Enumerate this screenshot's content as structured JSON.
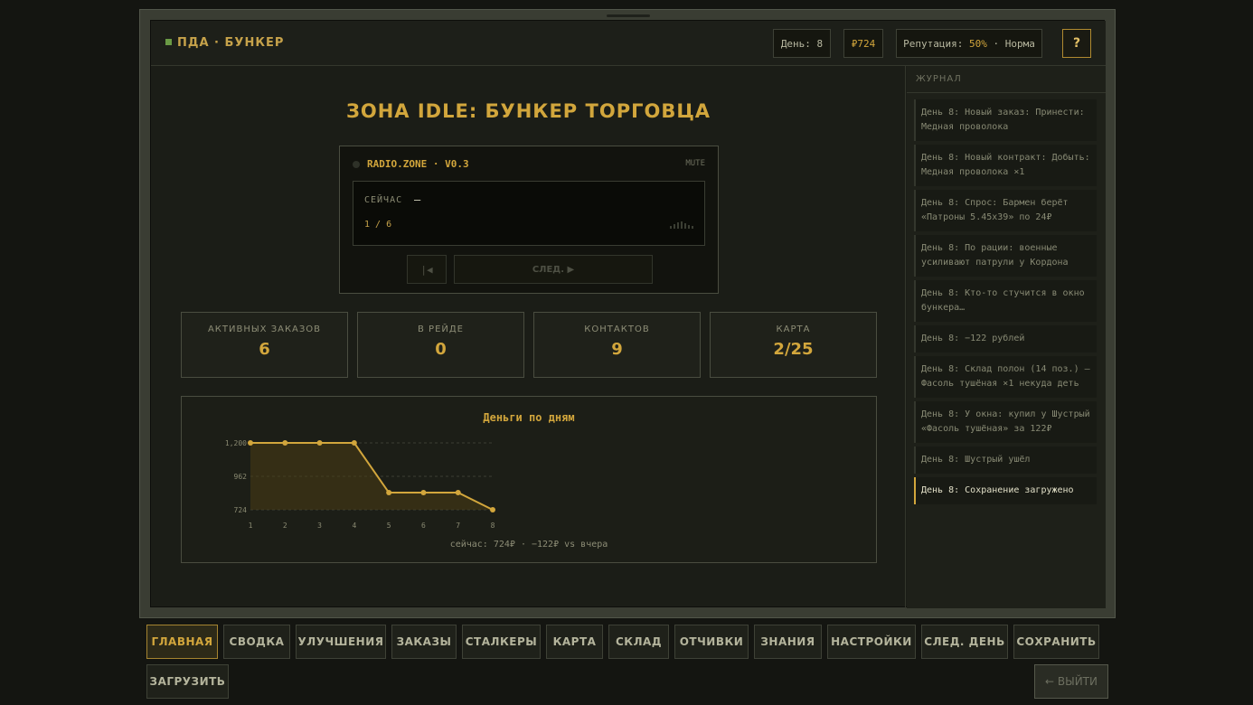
{
  "header": {
    "brand": "ПДА · БУНКЕР",
    "day": "День: 8",
    "money": "₽724",
    "reputation_label": "Репутация: ",
    "reputation_value": "50%",
    "reputation_status": " · Норма",
    "help": "?"
  },
  "main": {
    "title": "ЗОНА IDLE: БУНКЕР ТОРГОВЦА",
    "radio": {
      "name": "RADIO.ZONE · V0.3",
      "mute": "MUTE",
      "now_label": "СЕЙЧАС",
      "now_value": "—",
      "track_count": "1 / 6",
      "prev": "|◀",
      "next": "СЛЕД. ▶"
    },
    "stats": [
      {
        "label": "АКТИВНЫХ ЗАКАЗОВ",
        "value": "6"
      },
      {
        "label": "В РЕЙДЕ",
        "value": "0"
      },
      {
        "label": "КОНТАКТОВ",
        "value": "9"
      },
      {
        "label": "КАРТА",
        "value": "2/25"
      }
    ],
    "chart_footer": "сейчас: 724₽ · −122₽ vs вчера"
  },
  "chart_data": {
    "type": "area",
    "title": "Деньги по дням",
    "x": [
      1,
      2,
      3,
      4,
      5,
      6,
      7,
      8
    ],
    "series": [
      {
        "values": [
          1200,
          1200,
          1200,
          1200,
          846,
          846,
          846,
          724
        ]
      }
    ],
    "yticks": [
      "1,200",
      "962",
      "724"
    ],
    "ylim": [
      724,
      1200
    ],
    "grid": true,
    "colors": {
      "line": "#d2a63c",
      "fill": "#4a3c14"
    }
  },
  "journal": {
    "title": "ЖУРНАЛ",
    "entries": [
      {
        "text": "День 8: Новый заказ: Принести: Медная проволока"
      },
      {
        "text": "День 8: Новый контракт: Добыть: Медная проволока ×1"
      },
      {
        "text": "День 8: Спрос: Бармен берёт «Патроны 5.45x39» по 24₽"
      },
      {
        "text": "День 8: По рации: военные усиливают патрули у Кордона"
      },
      {
        "text": "День 8: Кто-то стучится в окно бункера…"
      },
      {
        "text": "День 8: −122 рублей"
      },
      {
        "text": "День 8: Склад полон (14 поз.) — Фасоль тушёная ×1 некуда деть"
      },
      {
        "text": "День 8: У окна: купил у Шустрый «Фасоль тушёная» за 122₽"
      },
      {
        "text": "День 8: Шустрый ушёл"
      },
      {
        "text": "День 8: Сохранение загружено",
        "active": true
      }
    ]
  },
  "nav": {
    "home": "ГЛАВНАЯ",
    "summary": "СВОДКА",
    "upgrades": "УЛУЧШЕНИЯ",
    "orders": "ЗАКАЗЫ",
    "stalkers": "СТАЛКЕРЫ",
    "map": "КАРТА",
    "warehouse": "СКЛАД",
    "reports": "ОТЧИВКИ",
    "knowledge": "ЗНАНИЯ",
    "settings": "НАСТРОЙКИ",
    "next_day": "СЛЕД. ДЕНЬ",
    "save": "СОХРАНИТЬ",
    "load": "ЗАГРУЗИТЬ",
    "exit": "← ВЫЙТИ"
  }
}
